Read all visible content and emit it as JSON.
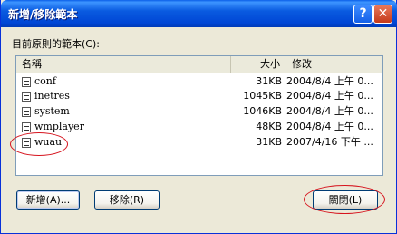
{
  "window": {
    "title": "新增/移除範本",
    "help_label": "?",
    "close_label": "✕"
  },
  "templates_label": "目前原則的範本(C):",
  "list": {
    "headers": {
      "name": "名稱",
      "size": "大小",
      "modified": "修改"
    },
    "rows": [
      {
        "name": "conf",
        "size": "31KB",
        "modified": "2004/8/4 上午 0..."
      },
      {
        "name": "inetres",
        "size": "1045KB",
        "modified": "2004/8/4 上午 0..."
      },
      {
        "name": "system",
        "size": "1046KB",
        "modified": "2004/8/4 上午 0..."
      },
      {
        "name": "wmplayer",
        "size": "48KB",
        "modified": "2004/8/4 上午 0..."
      },
      {
        "name": "wuau",
        "size": "31KB",
        "modified": "2007/4/16 下午 ..."
      }
    ]
  },
  "buttons": {
    "add": "新增(A)...",
    "remove": "移除(R)",
    "close": "關閉(L)"
  },
  "colors": {
    "titlebar": "#0054E3",
    "annotation": "#D6141E",
    "dialog_bg": "#ECE9D8"
  }
}
